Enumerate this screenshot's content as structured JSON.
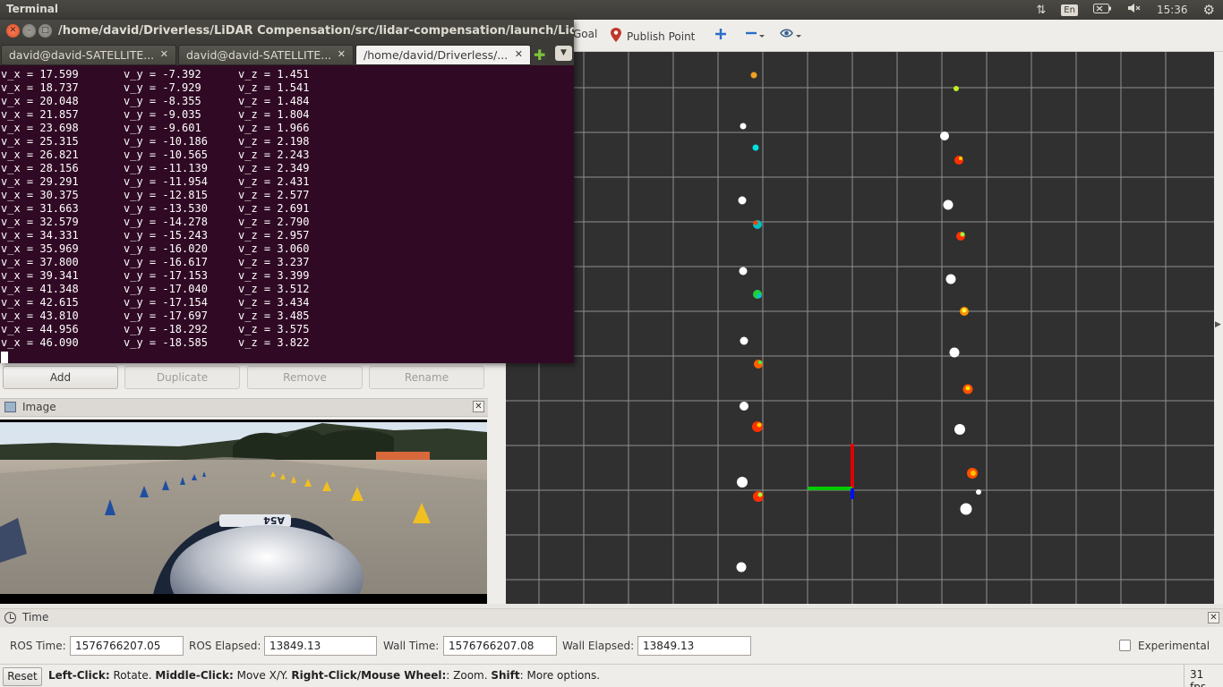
{
  "top_panel": {
    "app_title": "Terminal",
    "lang": "En",
    "clock": "15:36"
  },
  "terminal": {
    "title": "/home/david/Driverless/LiDAR Compensation/src/lidar-compensation/launch/LidarCompensation",
    "tabs": [
      {
        "label": "david@david-SATELLITE..."
      },
      {
        "label": "david@david-SATELLITE..."
      },
      {
        "label": "/home/david/Driverless/..."
      }
    ],
    "lines": [
      {
        "vx": "v_x = 17.599",
        "vy": "v_y = -7.392",
        "vz": "v_z = 1.451"
      },
      {
        "vx": "v_x = 18.737",
        "vy": "v_y = -7.929",
        "vz": "v_z = 1.541"
      },
      {
        "vx": "v_x = 20.048",
        "vy": "v_y = -8.355",
        "vz": "v_z = 1.484"
      },
      {
        "vx": "v_x = 21.857",
        "vy": "v_y = -9.035",
        "vz": "v_z = 1.804"
      },
      {
        "vx": "v_x = 23.698",
        "vy": "v_y = -9.601",
        "vz": "v_z = 1.966"
      },
      {
        "vx": "v_x = 25.315",
        "vy": "v_y = -10.186",
        "vz": "v_z = 2.198"
      },
      {
        "vx": "v_x = 26.821",
        "vy": "v_y = -10.565",
        "vz": "v_z = 2.243"
      },
      {
        "vx": "v_x = 28.156",
        "vy": "v_y = -11.139",
        "vz": "v_z = 2.349"
      },
      {
        "vx": "v_x = 29.291",
        "vy": "v_y = -11.954",
        "vz": "v_z = 2.431"
      },
      {
        "vx": "v_x = 30.375",
        "vy": "v_y = -12.815",
        "vz": "v_z = 2.577"
      },
      {
        "vx": "v_x = 31.663",
        "vy": "v_y = -13.530",
        "vz": "v_z = 2.691"
      },
      {
        "vx": "v_x = 32.579",
        "vy": "v_y = -14.278",
        "vz": "v_z = 2.790"
      },
      {
        "vx": "v_x = 34.331",
        "vy": "v_y = -15.243",
        "vz": "v_z = 2.957"
      },
      {
        "vx": "v_x = 35.969",
        "vy": "v_y = -16.020",
        "vz": "v_z = 3.060"
      },
      {
        "vx": "v_x = 37.800",
        "vy": "v_y = -16.617",
        "vz": "v_z = 3.237"
      },
      {
        "vx": "v_x = 39.341",
        "vy": "v_y = -17.153",
        "vz": "v_z = 3.399"
      },
      {
        "vx": "v_x = 41.348",
        "vy": "v_y = -17.040",
        "vz": "v_z = 3.512"
      },
      {
        "vx": "v_x = 42.615",
        "vy": "v_y = -17.154",
        "vz": "v_z = 3.434"
      },
      {
        "vx": "v_x = 43.810",
        "vy": "v_y = -17.697",
        "vz": "v_z = 3.485"
      },
      {
        "vx": "v_x = 44.956",
        "vy": "v_y = -18.292",
        "vz": "v_z = 3.575"
      },
      {
        "vx": "v_x = 46.090",
        "vy": "v_y = -18.585",
        "vz": "v_z = 3.822"
      }
    ]
  },
  "rviz_toolbar": {
    "goal_label": "Goal",
    "publish_point_label": "Publish Point"
  },
  "displays": {
    "add": "Add",
    "duplicate": "Duplicate",
    "remove": "Remove",
    "rename": "Rename"
  },
  "image_panel": {
    "title": "Image",
    "car_number": "A54"
  },
  "time_panel": {
    "title": "Time",
    "ros_time_label": "ROS Time:",
    "ros_time": "1576766207.05",
    "ros_elapsed_label": "ROS Elapsed:",
    "ros_elapsed": "13849.13",
    "wall_time_label": "Wall Time:",
    "wall_time": "1576766207.08",
    "wall_elapsed_label": "Wall Elapsed:",
    "wall_elapsed": "13849.13",
    "experimental_label": "Experimental"
  },
  "status_bar": {
    "reset": "Reset",
    "hint_1_key": "Left-Click:",
    "hint_1": " Rotate. ",
    "hint_2_key": "Middle-Click:",
    "hint_2": " Move X/Y. ",
    "hint_3_key": "Right-Click/Mouse Wheel:",
    "hint_3": ": Zoom. ",
    "hint_4_key": "Shift",
    "hint_4": ": More options.",
    "fps": "31 fps"
  },
  "colors": {
    "terminal_bg": "#300a24",
    "viewport_bg": "#303030",
    "grid": "#a0a0a0",
    "axis_x": "#e00000",
    "axis_y": "#00cc00",
    "axis_z": "#0000ff"
  },
  "icons": [
    "sort-arrows-icon",
    "keyboard-icon",
    "battery-icon",
    "volume-icon",
    "gear-icon",
    "map-pin-icon",
    "plus-move-icon",
    "minus-icon",
    "eye-icon"
  ]
}
